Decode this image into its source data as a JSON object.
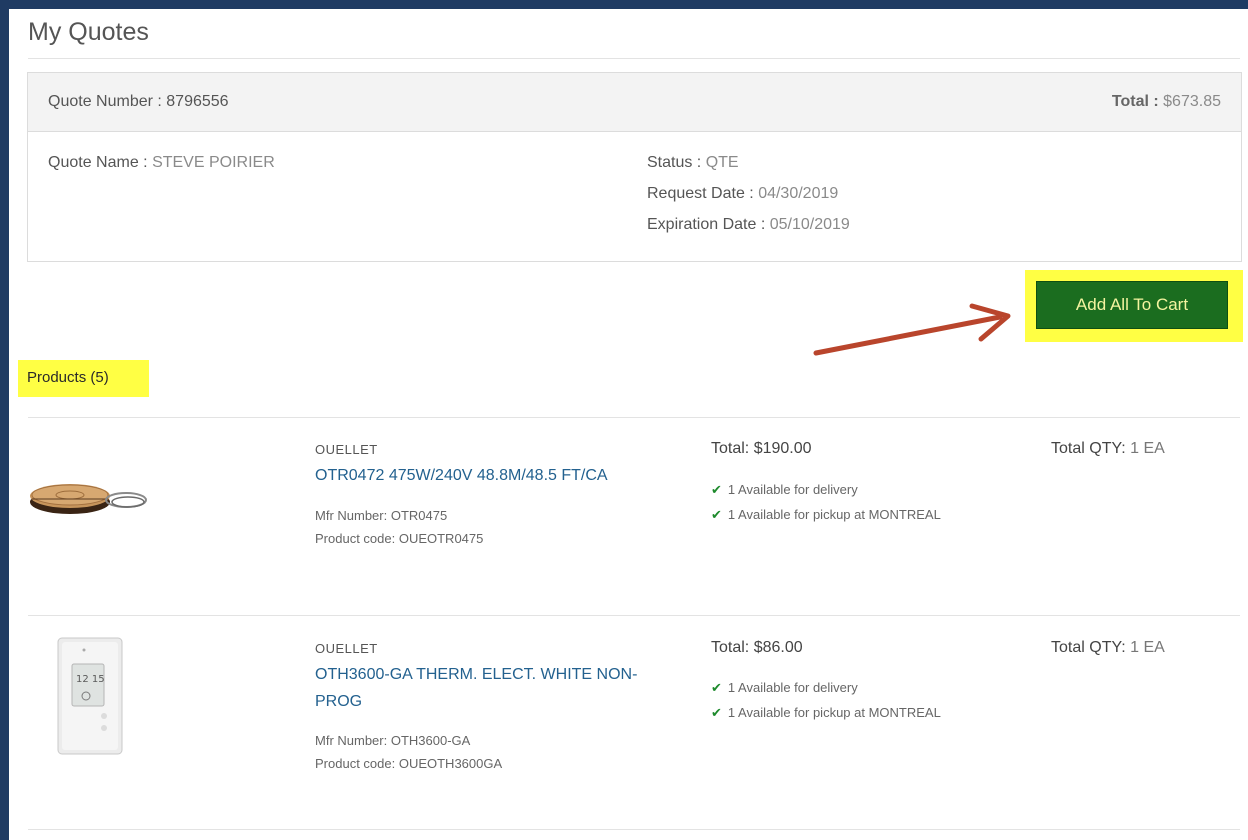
{
  "page": {
    "title": "My Quotes"
  },
  "quote": {
    "number_label": "Quote Number :",
    "number": "8796556",
    "total_label": "Total :",
    "total": "$673.85",
    "name_label": "Quote Name :",
    "name": "STEVE POIRIER",
    "status_label": "Status :",
    "status": "QTE",
    "request_date_label": "Request Date :",
    "request_date": "04/30/2019",
    "expiration_date_label": "Expiration Date :",
    "expiration_date": "05/10/2019"
  },
  "actions": {
    "add_all_label": "Add All To Cart"
  },
  "products": {
    "heading": "Products (5)",
    "items": [
      {
        "brand": "OUELLET",
        "name": "OTR0472 475W/240V 48.8M/48.5 FT/CA",
        "mfr": "Mfr Number: OTR0475",
        "code": "Product code: OUEOTR0475",
        "total": "Total: $190.00",
        "delivery": "1 Available for delivery",
        "pickup": "1 Available for pickup at MONTREAL",
        "qty_label": "Total QTY:",
        "qty": "1 EA",
        "icon": "heating-cable-image"
      },
      {
        "brand": "OUELLET",
        "name": "OTH3600-GA THERM. ELECT. WHITE NON-PROG",
        "mfr": "Mfr Number: OTH3600-GA",
        "code": "Product code: OUEOTH3600GA",
        "total": "Total: $86.00",
        "delivery": "1 Available for delivery",
        "pickup": "1 Available for pickup at MONTREAL",
        "qty_label": "Total QTY:",
        "qty": "1 EA",
        "icon": "thermostat-image",
        "image_text": "12 15"
      }
    ]
  },
  "colors": {
    "button_bg": "#1b6d1f",
    "highlight": "#ffff44",
    "link": "#23618f",
    "arrow": "#b9452c",
    "check": "#1d8a2c",
    "frame": "#1f3b63"
  }
}
